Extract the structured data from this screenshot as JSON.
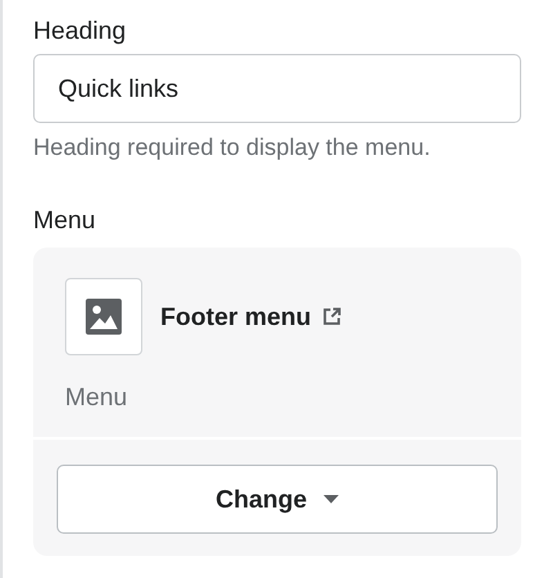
{
  "heading_field": {
    "label": "Heading",
    "value": "Quick links",
    "help_text": "Heading required to display the menu."
  },
  "menu_field": {
    "label": "Menu",
    "selected_menu": {
      "title": "Footer menu",
      "subtitle": "Menu"
    },
    "change_button": {
      "label": "Change"
    }
  }
}
